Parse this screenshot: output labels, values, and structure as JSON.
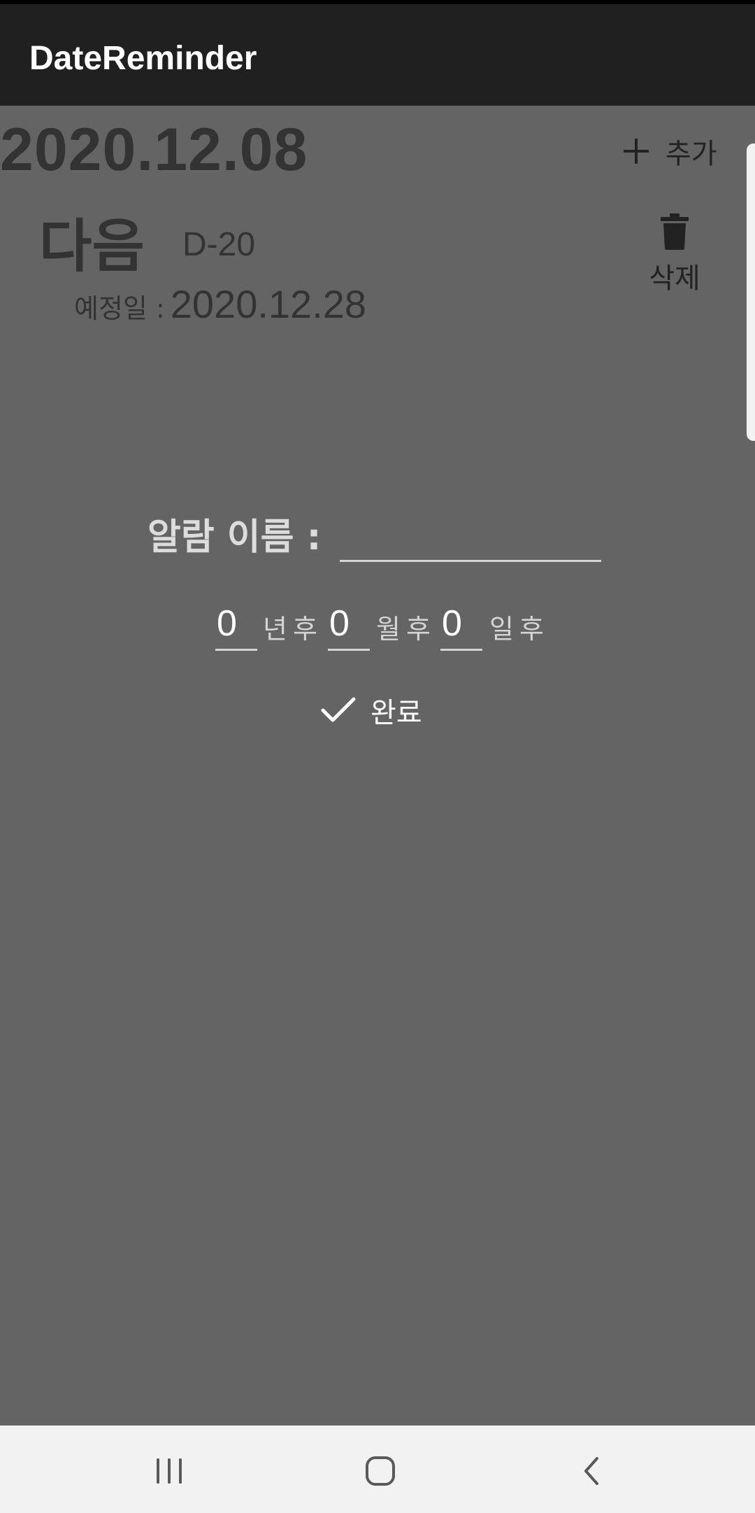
{
  "app_bar": {
    "title": "DateReminder"
  },
  "header": {
    "today_date": "2020.12.08",
    "add_label": "추가"
  },
  "reminder": {
    "title": "다음",
    "dday": "D-20",
    "due_label": "예정일 :",
    "due_date": "2020.12.28",
    "delete_label": "삭제"
  },
  "dialog": {
    "name_label": "알람 이름 :",
    "name_value": "",
    "years_value": "0",
    "years_unit": "년후",
    "months_value": "0",
    "months_unit": "월후",
    "days_value": "0",
    "days_unit": "일후",
    "done_label": "완료"
  },
  "nav": {
    "recents": "recent-apps-icon",
    "home": "home-icon",
    "back": "back-icon"
  },
  "colors": {
    "app_bar": "#202020",
    "dim_background": "#646464",
    "nav_bar": "#f2f2f2"
  }
}
